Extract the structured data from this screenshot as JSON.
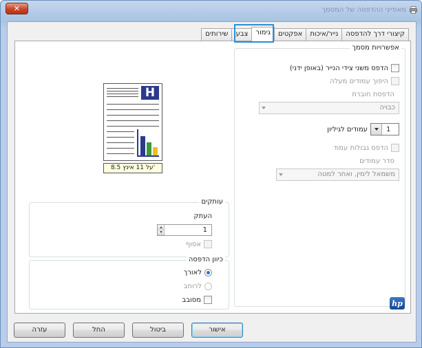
{
  "window": {
    "title": "מאפייני ההדפסה של המסמך",
    "close_glyph": "✕"
  },
  "tabs": [
    {
      "label": "קיצורי דרך להדפסה"
    },
    {
      "label": "נייר/איכות"
    },
    {
      "label": "אפקטים"
    },
    {
      "label": "גימור",
      "active": true
    },
    {
      "label": "צבע"
    },
    {
      "label": "שירותים"
    }
  ],
  "document_options": {
    "legend": "אפשרויות מסמך",
    "print_both_sides": "הדפס משני צידי הנייר (באופן ידני)",
    "flip_pages_up": "היפוך עמודים מעלה",
    "booklet_layout_label": "הדפסת חוברת",
    "booklet_layout_value": "כבויה",
    "pages_per_sheet_value": "1",
    "pages_per_sheet_label": "עמודים לגיליון",
    "print_page_borders": "הדפס גבולות עמוד",
    "page_order_label": "סדר עמודים",
    "page_order_value": "משמאל לימין, ואחר למטה"
  },
  "preview": {
    "paper_size": "8.5 על 11 אינץ'",
    "letter": "H",
    "bar_colors": [
      "#2b3a8c",
      "#3a9a3a",
      "#e8c020"
    ]
  },
  "copies": {
    "legend": "עותקים",
    "copies_label": "העתק",
    "copies_value": "1",
    "collate": "אסוף"
  },
  "orientation": {
    "legend": "כיוון הדפסה",
    "portrait": "לאורך",
    "landscape": "לרוחב",
    "rotate": "מסובב"
  },
  "logo": {
    "text": "hp"
  },
  "buttons": {
    "ok": "אישור",
    "cancel": "ביטול",
    "apply": "החל",
    "help": "עזרה"
  }
}
